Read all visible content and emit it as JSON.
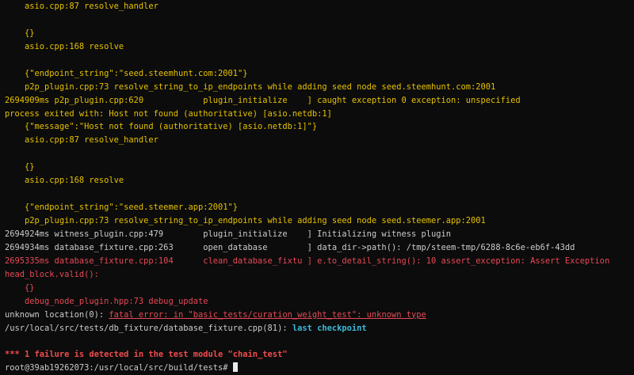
{
  "terminal": {
    "lines": [
      "    asio.cpp:87 resolve_handler",
      "",
      "    {}",
      "    asio.cpp:168 resolve",
      "",
      "    {\"endpoint_string\":\"seed.steemhunt.com:2001\"}",
      "    p2p_plugin.cpp:73 resolve_string_to_ip_endpoints while adding seed node seed.steemhunt.com:2001",
      "2694909ms p2p_plugin.cpp:620            plugin_initialize    ] caught exception 0 exception: unspecified",
      "process exited with: Host not found (authoritative) [asio.netdb:1]",
      "    {\"message\":\"Host not found (authoritative) [asio.netdb:1]\"}",
      "    asio.cpp:87 resolve_handler",
      "",
      "    {}",
      "    asio.cpp:168 resolve",
      "",
      "    {\"endpoint_string\":\"seed.steemer.app:2001\"}",
      "    p2p_plugin.cpp:73 resolve_string_to_ip_endpoints while adding seed node seed.steemer.app:2001",
      "2694924ms witness_plugin.cpp:479        plugin_initialize    ] Initializing witness plugin",
      "2694934ms database_fixture.cpp:263      open_database        ] data_dir->path(): /tmp/steem-tmp/6288-8c6e-eb6f-43dd",
      "2695335ms database_fixture.cpp:104      clean_database_fixtu ] e.to_detail_string(): 10 assert_exception: Assert Exception",
      "head_block.valid():",
      "    {}",
      "    debug_node_plugin.hpp:73 debug_update"
    ],
    "error_line": {
      "prefix": "unknown location(0): ",
      "message": "fatal error: in \"basic_tests/curation_weight_test\": unknown type"
    },
    "checkpoint_line": {
      "path": "/usr/local/src/tests/db_fixture/database_fixture.cpp(81): ",
      "label": "last checkpoint"
    },
    "blank_line": "",
    "failure_line": "*** 1 failure is detected in the test module \"chain_test\"",
    "prompt": "root@39ab19262073:/usr/local/src/build/tests# ",
    "colors": {
      "background": "#0c0c0c",
      "default": "#cccccc",
      "yellow": "#e5c100",
      "red": "#e74856",
      "cyan": "#3bb8d9"
    }
  }
}
